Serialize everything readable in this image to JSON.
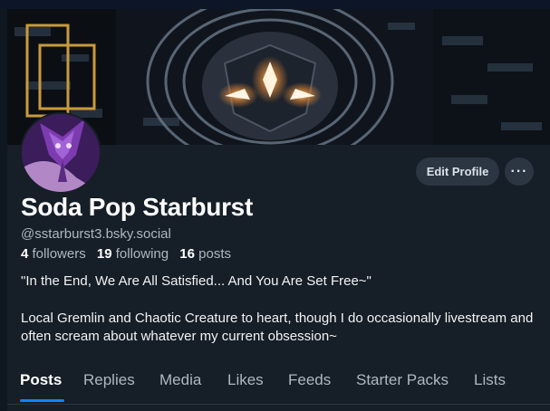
{
  "profile": {
    "display_name": "Soda Pop Starburst",
    "handle": "@sstarburst3.bsky.social",
    "followers_count": "4",
    "followers_label": "followers",
    "following_count": "19",
    "following_label": "following",
    "posts_count": "16",
    "posts_label": "posts",
    "bio_line1": "\"In the End, We Are All Satisfied... And You Are Set Free~\"",
    "bio_line2": "Local Gremlin and Chaotic Creature to heart, though I do occasionally livestream and often scream about whatever my current obsession~"
  },
  "actions": {
    "edit_profile_label": "Edit Profile",
    "more_icon": "more-horizontal-icon"
  },
  "tabs": [
    {
      "label": "Posts",
      "active": true
    },
    {
      "label": "Replies",
      "active": false
    },
    {
      "label": "Media",
      "active": false
    },
    {
      "label": "Likes",
      "active": false
    },
    {
      "label": "Feeds",
      "active": false
    },
    {
      "label": "Starter Packs",
      "active": false
    },
    {
      "label": "Lists",
      "active": false
    }
  ],
  "colors": {
    "background": "#161e27",
    "button_bg": "#2b3642",
    "accent": "#1083fe",
    "muted_text": "#aeb8c2"
  }
}
